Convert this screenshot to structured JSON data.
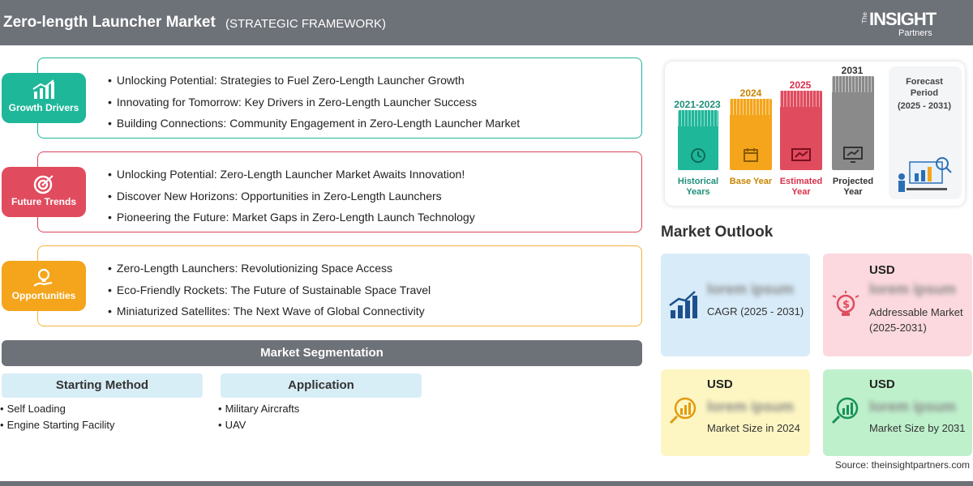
{
  "header": {
    "title": "Zero-length Launcher Market",
    "subtitle": "(STRATEGIC FRAMEWORK)",
    "logo_the": "The",
    "logo_insight": "INSIGHT",
    "logo_partners": "Partners"
  },
  "framework": [
    {
      "tag": "Growth Drivers",
      "icon": "bar-chart-icon",
      "color": "#1fb799",
      "items": [
        "Unlocking Potential: Strategies to Fuel Zero-Length Launcher Growth",
        "Innovating for Tomorrow: Key Drivers in Zero-Length Launcher Success",
        "Building Connections: Community Engagement in Zero-Length Launcher Market"
      ]
    },
    {
      "tag": "Future Trends",
      "icon": "target-icon",
      "color": "#e04b5e",
      "items": [
        "Unlocking Potential: Zero-Length Launcher Market Awaits Innovation!",
        "Discover New Horizons: Opportunities in Zero-Length Launchers",
        "Pioneering the Future: Market Gaps in Zero-Length Launch Technology"
      ]
    },
    {
      "tag": "Opportunities",
      "icon": "lightbulb-hand-icon",
      "color": "#f4a51c",
      "items": [
        "Zero-Length Launchers: Revolutionizing Space Access",
        "Eco-Friendly Rockets: The Future of Sustainable Space Travel",
        "Miniaturized Satellites: The Next Wave of Global Connectivity"
      ]
    }
  ],
  "segmentation": {
    "title": "Market Segmentation",
    "columns": [
      {
        "heading": "Starting Method",
        "items": [
          "Self Loading",
          "Engine Starting Facility"
        ]
      },
      {
        "heading": "Application",
        "items": [
          "Military Aircrafts",
          "UAV"
        ]
      }
    ]
  },
  "timeline": {
    "periods": [
      {
        "year": "2021-2023",
        "label": "Historical Years",
        "color": "#1fb799"
      },
      {
        "year": "2024",
        "label": "Base Year",
        "color": "#f4a51c"
      },
      {
        "year": "2025",
        "label": "Estimated Year",
        "color": "#e04b5e"
      },
      {
        "year": "2031",
        "label": "Projected Year",
        "color": "#8a8a8a"
      }
    ],
    "forecast_title": "Forecast Period",
    "forecast_range": "(2025 - 2031)"
  },
  "outlook": {
    "title": "Market Outlook",
    "boxes": [
      {
        "usd": "",
        "value": "lorem ipsum",
        "desc": "CAGR (2025 - 2031)"
      },
      {
        "usd": "USD",
        "value": "lorem ipsum",
        "desc": "Addressable Market (2025-2031)"
      },
      {
        "usd": "USD",
        "value": "lorem ipsum",
        "desc": "Market Size in 2024"
      },
      {
        "usd": "USD",
        "value": "lorem ipsum",
        "desc": "Market Size by 2031"
      }
    ]
  },
  "source": "Source: theinsightpartners.com"
}
